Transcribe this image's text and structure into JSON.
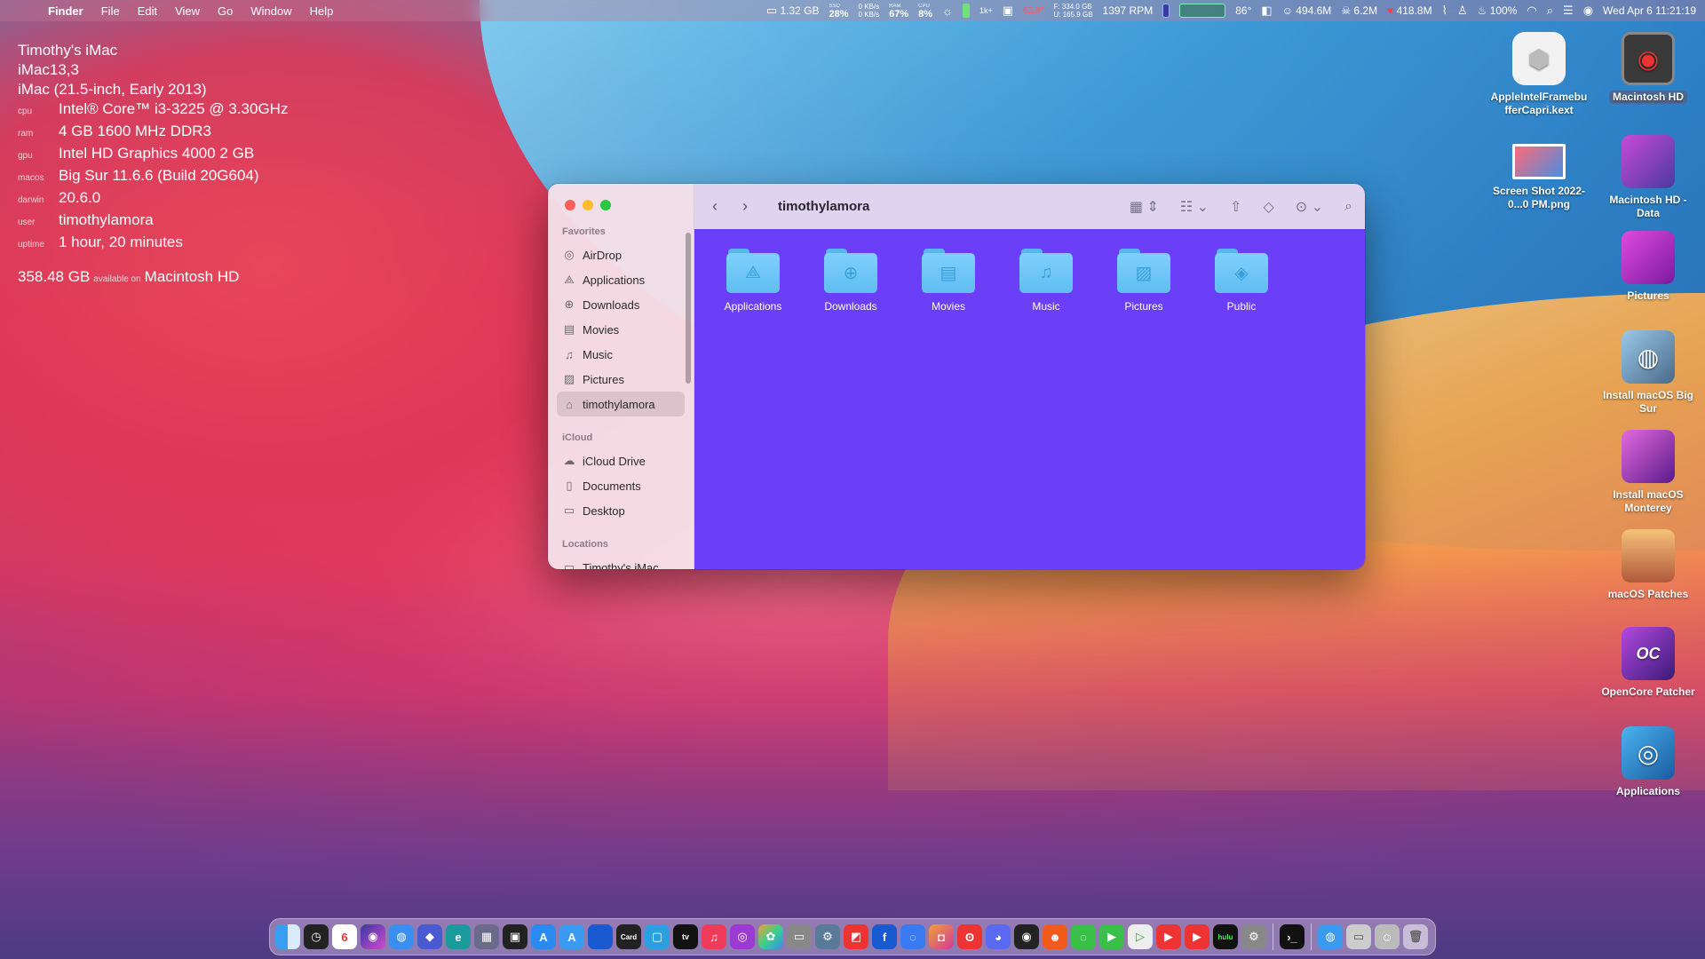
{
  "menubar": {
    "app_name": "Finder",
    "menus": [
      "File",
      "Edit",
      "View",
      "Go",
      "Window",
      "Help"
    ],
    "memory": "1.32 GB",
    "ssd_label": "SSD",
    "ssd_value": "28%",
    "net_up": "0 KB/s",
    "net_down": "0 KB/s",
    "ram_label": "RAM",
    "ram_value": "67%",
    "cpu_label": "CPU",
    "cpu_value": "8%",
    "badge_1k": "1k+",
    "temp_red": "62.8°",
    "disk_free": "F: 334.0 GB",
    "disk_used": "U: 165.9 GB",
    "fan": "1397 RPM",
    "temp": "86°",
    "stat_a": "494.6M",
    "stat_b": "6.2M",
    "stat_c": "418.8M",
    "battery": "100%",
    "clock": "Wed Apr 6  11:21:19"
  },
  "sysinfo": {
    "name": "Timothy's iMac",
    "model": "iMac13,3",
    "model_desc": "iMac (21.5-inch, Early 2013)",
    "rows": [
      {
        "key": "cpu",
        "value": "Intel® Core™ i3-3225 @ 3.30GHz"
      },
      {
        "key": "ram",
        "value": "4 GB 1600 MHz DDR3"
      },
      {
        "key": "gpu",
        "value": "Intel HD Graphics 4000 2 GB"
      },
      {
        "key": "macos",
        "value": "Big Sur 11.6.6 (Build 20G604)"
      },
      {
        "key": "darwin",
        "value": "20.6.0"
      },
      {
        "key": "user",
        "value": "timothylamora"
      },
      {
        "key": "uptime",
        "value": "1 hour, 20 minutes"
      }
    ],
    "disk_amount": "358.48 GB",
    "disk_avail": "available on",
    "disk_name": "Macintosh HD"
  },
  "desktop": {
    "kext": "AppleIntelFramebufferCapri.kext",
    "hd": "Macintosh HD",
    "screenshot": "Screen Shot 2022-0...0 PM.png",
    "hd_data": "Macintosh HD - Data",
    "pictures": "Pictures",
    "install_bigsur": "Install macOS Big Sur",
    "install_monterey": "Install macOS Monterey",
    "patches": "macOS Patches",
    "opencore": "OpenCore Patcher",
    "applications": "Applications"
  },
  "finder": {
    "title": "timothylamora",
    "sidebar": {
      "favorites_header": "Favorites",
      "favorites": [
        "AirDrop",
        "Applications",
        "Downloads",
        "Movies",
        "Music",
        "Pictures",
        "timothylamora"
      ],
      "icloud_header": "iCloud",
      "icloud": [
        "iCloud Drive",
        "Documents",
        "Desktop"
      ],
      "locations_header": "Locations",
      "locations": [
        "Timothy's iMac"
      ]
    },
    "folders": [
      "Applications",
      "Downloads",
      "Movies",
      "Music",
      "Pictures",
      "Public"
    ],
    "content_color": "#6a3ff7"
  }
}
